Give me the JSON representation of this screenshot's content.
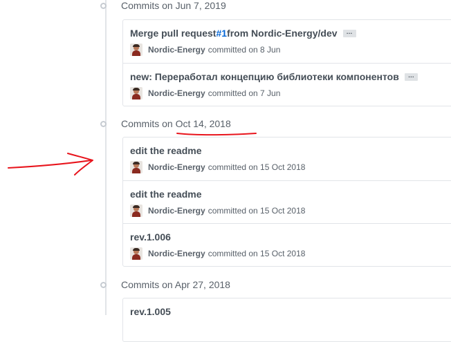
{
  "groups": [
    {
      "title": "Commits on Jun 7, 2019",
      "commits": [
        {
          "title_prefix": "Merge pull request ",
          "pr_link": "#1",
          "title_suffix": " from Nordic-Energy/dev",
          "has_ellipsis": true,
          "author": "Nordic-Energy",
          "meta": "committed on 8 Jun"
        },
        {
          "title_prefix": "new: Переработал концепцию библиотеки компонентов",
          "pr_link": "",
          "title_suffix": "",
          "has_ellipsis": true,
          "author": "Nordic-Energy",
          "meta": "committed on 7 Jun"
        }
      ]
    },
    {
      "title": "Commits on Oct 14, 2018",
      "commits": [
        {
          "title_prefix": "edit the readme",
          "pr_link": "",
          "title_suffix": "",
          "has_ellipsis": false,
          "author": "Nordic-Energy",
          "meta": "committed on 15 Oct 2018"
        },
        {
          "title_prefix": "edit the readme",
          "pr_link": "",
          "title_suffix": "",
          "has_ellipsis": false,
          "author": "Nordic-Energy",
          "meta": "committed on 15 Oct 2018"
        },
        {
          "title_prefix": "rev.1.006",
          "pr_link": "",
          "title_suffix": "",
          "has_ellipsis": false,
          "author": "Nordic-Energy",
          "meta": "committed on 15 Oct 2018"
        }
      ]
    },
    {
      "title": "Commits on Apr 27, 2018",
      "commits": [
        {
          "title_prefix": "rev.1.005",
          "pr_link": "",
          "title_suffix": "",
          "has_ellipsis": false,
          "author": "",
          "meta": ""
        }
      ]
    }
  ],
  "ellipsis_label": "…",
  "colors": {
    "annotation": "#e8141c",
    "link": "#0366d6"
  },
  "icons": {
    "commit_dot": "commit-node-icon",
    "avatar": "user-avatar"
  }
}
